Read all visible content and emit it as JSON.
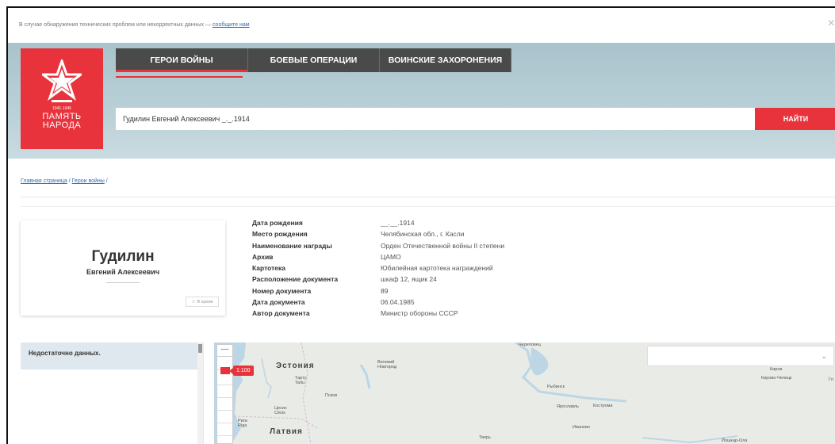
{
  "notice": {
    "text": "В случае обнаружения технических проблем или некорректных данных — ",
    "link": "сообщите нам",
    "close": "×"
  },
  "logo": {
    "years": "1941-1945",
    "line1": "ПАМЯТЬ",
    "line2": "НАРОДА",
    "brand_color": "#e8333c"
  },
  "tabs": [
    {
      "label": "ГЕРОИ ВОЙНЫ"
    },
    {
      "label": "БОЕВЫЕ ОПЕРАЦИИ"
    },
    {
      "label": "ВОИНСКИЕ ЗАХОРОНЕНИЯ"
    }
  ],
  "search": {
    "value": "Гудилин Евгений Алексеевич _._.1914",
    "button": "НАЙТИ"
  },
  "breadcrumb": {
    "home": "Главная страница",
    "sep": " / ",
    "section": "Герои войны",
    "trail": " /"
  },
  "person": {
    "surname": "Гудилин",
    "given": "Евгений Алексеевич",
    "archive_button": "В архив",
    "archive_icon": "star-icon"
  },
  "info": [
    {
      "label": "Дата рождения",
      "value": "__.__.1914"
    },
    {
      "label": "Место рождения",
      "value": "Челябинская обл., г. Касли"
    },
    {
      "label": "Наименование награды",
      "value": "Орден Отечественной войны II степени"
    },
    {
      "label": "Архив",
      "value": "ЦАМО"
    },
    {
      "label": "Картотека",
      "value": "Юбилейная картотека награждений"
    },
    {
      "label": "Расположение документа",
      "value": "шкаф 12, ящик 24"
    },
    {
      "label": "Номер документа",
      "value": "89"
    },
    {
      "label": "Дата документа",
      "value": "06.04.1985"
    },
    {
      "label": "Автор документа",
      "value": "Министр обороны СССР"
    }
  ],
  "panel": {
    "message": "Недостаточно данных."
  },
  "map": {
    "zoom_minus": "—",
    "scale": "1:100",
    "dropdown_icon": "chevron-down-icon",
    "countries": [
      "Эстония",
      "Латвия"
    ],
    "places": [
      "Тарту\nTartu",
      "Псков",
      "Великий\nНовгород",
      "Череповец",
      "Рыбинск",
      "Ярославль",
      "Кострома",
      "Киров",
      "Кирово-Чепецк",
      "Иваново",
      "Тверь",
      "Йошкар-Ола",
      "Рига\nRiga",
      "Цесис\nCēsis",
      "Гл"
    ]
  }
}
